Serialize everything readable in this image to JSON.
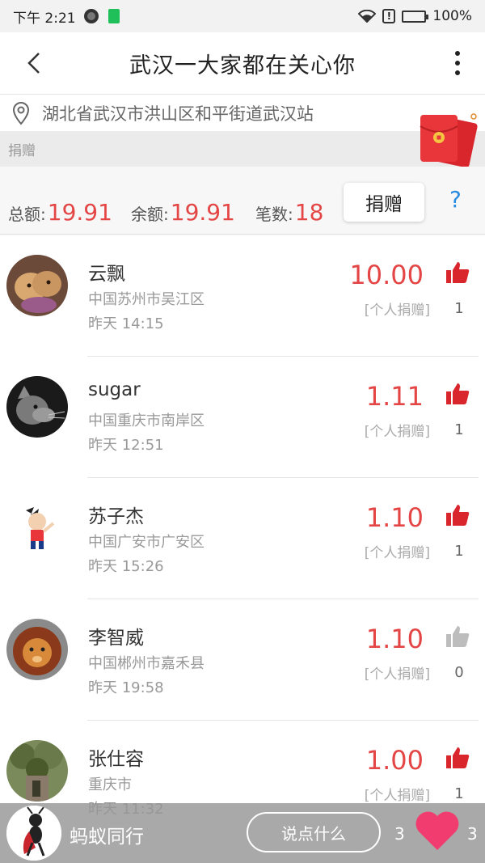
{
  "status_bar": {
    "time": "下午 2:21",
    "battery": "100%"
  },
  "nav": {
    "title": "武汉一大家都在关心你"
  },
  "location": {
    "text": "湖北省武汉市洪山区和平街道武汉站"
  },
  "section_label": "捐赠",
  "summary": {
    "total_label": "总额:",
    "total_value": "19.91",
    "balance_label": "余额:",
    "balance_value": "19.91",
    "count_label": "笔数:",
    "count_value": "18",
    "donate_label": "捐赠",
    "help_label": "?"
  },
  "donors": [
    {
      "name": "云飘",
      "location": "中国苏州市吴江区",
      "time": "昨天 14:15",
      "amount": "10.00",
      "type": "[个人捐赠]",
      "likes": "1",
      "liked": true,
      "avatar": "dog-avatar"
    },
    {
      "name": "sugar",
      "location": "中国重庆市南岸区",
      "time": "昨天 12:51",
      "amount": "1.11",
      "type": "[个人捐赠]",
      "likes": "1",
      "liked": true,
      "avatar": "cat-avatar"
    },
    {
      "name": "苏子杰",
      "location": "中国广安市广安区",
      "time": "昨天 15:26",
      "amount": "1.10",
      "type": "[个人捐赠]",
      "likes": "1",
      "liked": true,
      "avatar": "cartoon-avatar"
    },
    {
      "name": "李智威",
      "location": "中国郴州市嘉禾县",
      "time": "昨天 19:58",
      "amount": "1.10",
      "type": "[个人捐赠]",
      "likes": "0",
      "liked": false,
      "avatar": "lion-avatar"
    },
    {
      "name": "张仕容",
      "location": "重庆市",
      "time": "昨天 11:32",
      "amount": "1.00",
      "type": "[个人捐赠]",
      "likes": "1",
      "liked": true,
      "avatar": "tree-avatar"
    }
  ],
  "bottom_bar": {
    "name": "蚂蚁同行",
    "comment_placeholder": "说点什么",
    "comment_count": "3",
    "heart_count": "3"
  },
  "colors": {
    "accent_red": "#e44545",
    "help_blue": "#2a8ce0",
    "thumb_gray": "#bdbdbd",
    "heart_pink": "#f03c6e"
  }
}
